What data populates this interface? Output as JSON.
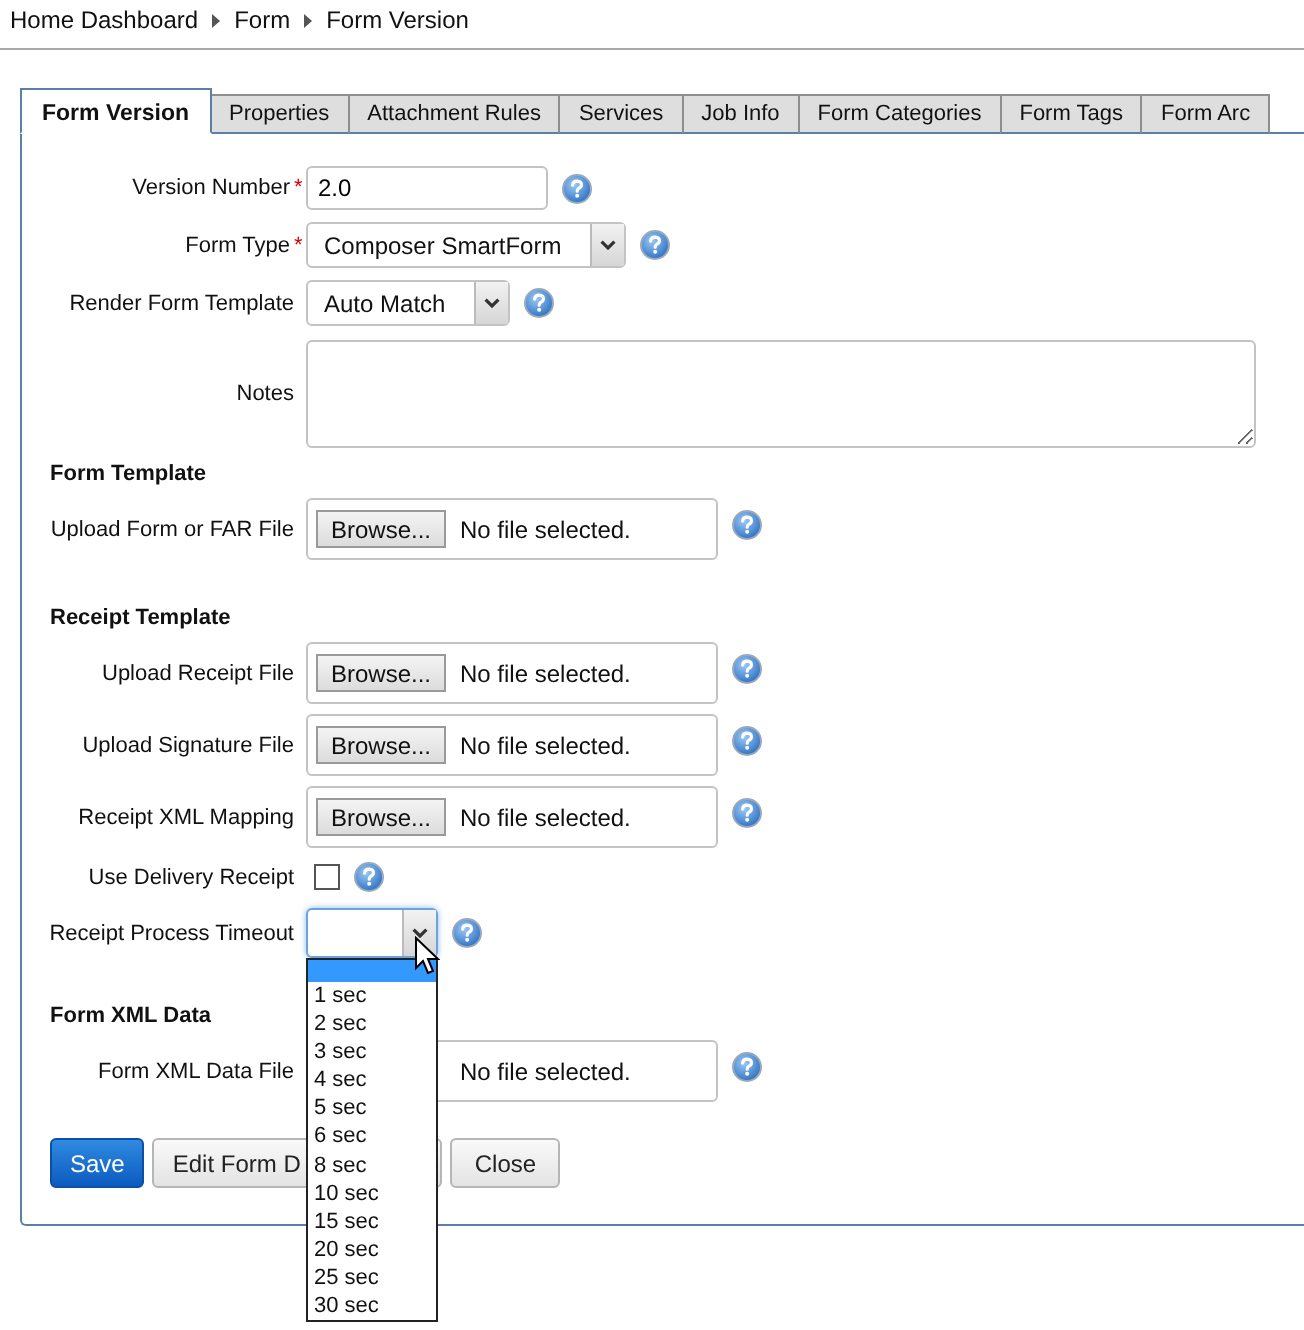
{
  "breadcrumb": [
    "Home Dashboard",
    "Form",
    "Form Version"
  ],
  "tabs": [
    {
      "label": "Form Version",
      "selected": true
    },
    {
      "label": "Properties",
      "selected": false
    },
    {
      "label": "Attachment Rules",
      "selected": false
    },
    {
      "label": "Services",
      "selected": false
    },
    {
      "label": "Job Info",
      "selected": false
    },
    {
      "label": "Form Categories",
      "selected": false
    },
    {
      "label": "Form Tags",
      "selected": false
    },
    {
      "label": "Form Arc",
      "selected": false
    }
  ],
  "form": {
    "rows": [
      {
        "kind": "text",
        "label": "Version Number",
        "required_mark": "*",
        "help": true,
        "value": "2.0"
      },
      {
        "kind": "select",
        "label": "Form Type",
        "required_mark": "*",
        "help": true,
        "value": "Composer SmartForm"
      },
      {
        "kind": "select",
        "label": "Render Form Template",
        "help": true,
        "value": "Auto Match"
      },
      {
        "kind": "textarea",
        "label": "Notes"
      },
      {
        "kind": "heading",
        "label": "Form Template"
      },
      {
        "kind": "file",
        "label": "Upload Form or FAR File",
        "help": true,
        "button": "Browse...",
        "status": "No file selected."
      },
      {
        "kind": "heading",
        "label": "Receipt Template"
      },
      {
        "kind": "file",
        "label": "Upload Receipt File",
        "help": true,
        "button": "Browse...",
        "status": "No file selected."
      },
      {
        "kind": "file",
        "label": "Upload Signature File",
        "help": true,
        "button": "Browse...",
        "status": "No file selected."
      },
      {
        "kind": "file",
        "label": "Receipt XML Mapping",
        "help": true,
        "button": "Browse...",
        "status": "No file selected."
      },
      {
        "kind": "checkbox",
        "label": "Use Delivery Receipt",
        "help": true,
        "checked": false
      },
      {
        "kind": "select",
        "label": "Receipt Process Timeout",
        "help": true,
        "open": true,
        "blank_option_selected": true,
        "options": [
          {
            "label": "1 sec",
            "selected": false
          },
          {
            "label": "2 sec",
            "selected": false
          },
          {
            "label": "3 sec",
            "selected": false
          },
          {
            "label": "4 sec",
            "selected": false
          },
          {
            "label": "5 sec",
            "selected": false
          },
          {
            "label": "6 sec",
            "selected": false
          },
          {
            "label": "8 sec",
            "selected": false
          },
          {
            "label": "10 sec",
            "selected": false
          },
          {
            "label": "15 sec",
            "selected": false
          },
          {
            "label": "20 sec",
            "selected": false
          },
          {
            "label": "25 sec",
            "selected": false
          },
          {
            "label": "30 sec",
            "selected": false
          }
        ]
      },
      {
        "kind": "heading",
        "label": "Form XML Data"
      },
      {
        "kind": "file",
        "label": "Form XML Data File",
        "help": true,
        "status": "No file selected."
      }
    ]
  },
  "buttons": [
    {
      "label": "Save",
      "kind": "primary"
    },
    {
      "label": "Edit Form D",
      "kind": "covered"
    },
    {
      "label": "Close",
      "kind": "default"
    }
  ]
}
